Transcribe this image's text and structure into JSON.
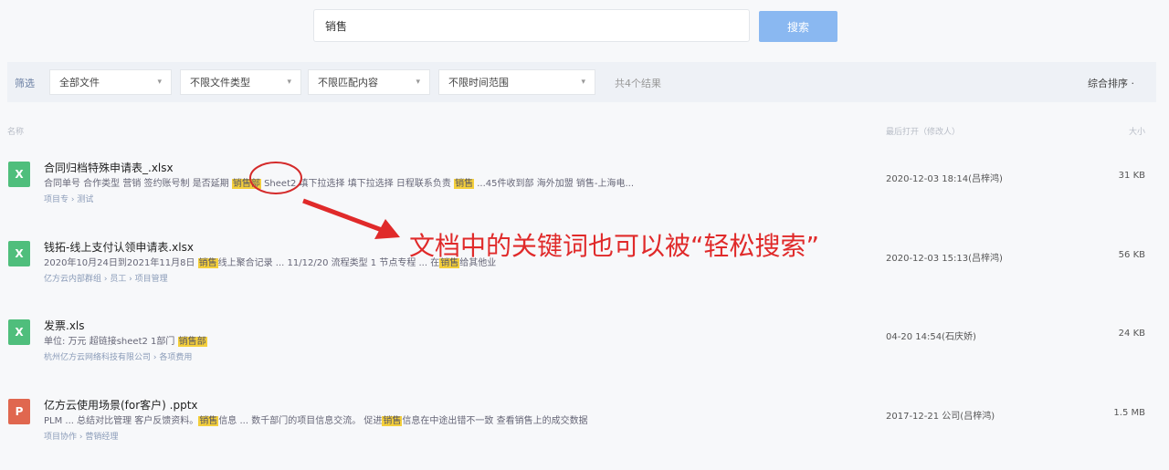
{
  "search": {
    "query": "销售",
    "button": "搜索"
  },
  "filters": {
    "label": "筛选",
    "dropdowns": [
      "全部文件",
      "不限文件类型",
      "不限匹配内容",
      "不限时间范围"
    ],
    "count": "共4个结果",
    "sort": "综合排序 ·"
  },
  "headers": {
    "name": "名称",
    "last_open": "最后打开（修改人）",
    "size": "大小"
  },
  "files": [
    {
      "icon": "X",
      "name": "合同归档特殊申请表_.xlsx",
      "snippet_pre": "合同单号  合作类型  营销  签约账号制  是否延期  ",
      "snippet_hl1": "销售部",
      "snippet_mid": "  Sheet2  填下拉选择  填下拉选择  日程联系负责  ",
      "snippet_hl2": "销售",
      "snippet_post": "  ...45件收到部  海外加盟  销售-上海电...",
      "path": "项目专 › 测试",
      "time": "2020-12-03 18:14(吕梓鸿)",
      "size": "31 KB"
    },
    {
      "icon": "X",
      "name": "钱拓-线上支付认领申请表.xlsx",
      "snippet_pre": "2020年10月24日到2021年11月8日  ",
      "snippet_hl1": "销售",
      "snippet_mid": "线上聚合记录  ...  11/12/20  流程类型  1  节点专程  ...  在",
      "snippet_hl2": "销售",
      "snippet_post": "给其他业",
      "path": "亿方云内部群组 › 员工 › 项目管理",
      "time": "2020-12-03 15:13(吕梓鸿)",
      "size": "56 KB"
    },
    {
      "icon": "X",
      "name": "发票.xls",
      "snippet_pre": "单位: 万元  超链接sheet2  1部门  ",
      "snippet_hl1": "销售部",
      "snippet_mid": "",
      "snippet_hl2": "",
      "snippet_post": "",
      "path": "杭州亿方云网络科技有限公司 › 各项费用",
      "time": "04-20 14:54(石庆娇)",
      "size": "24 KB"
    },
    {
      "icon": "P",
      "name": "亿方云使用场景(for客户) .pptx",
      "snippet_pre": "PLM  ...  总结对比管理  客户反馈资料。",
      "snippet_hl1": "销售",
      "snippet_mid": "信息  ...  数千部门的项目信息交流。  促进",
      "snippet_hl2": "销售",
      "snippet_post": "信息在中途出错不一致  查看销售上的成交数据",
      "path": "项目协作 › 营销经理",
      "time": "2017-12-21 公司(吕梓鸿)",
      "size": "1.5 MB"
    }
  ],
  "annotation": {
    "text": "文档中的关键词也可以被“轻松搜索”",
    "color": "#e02a2a"
  }
}
